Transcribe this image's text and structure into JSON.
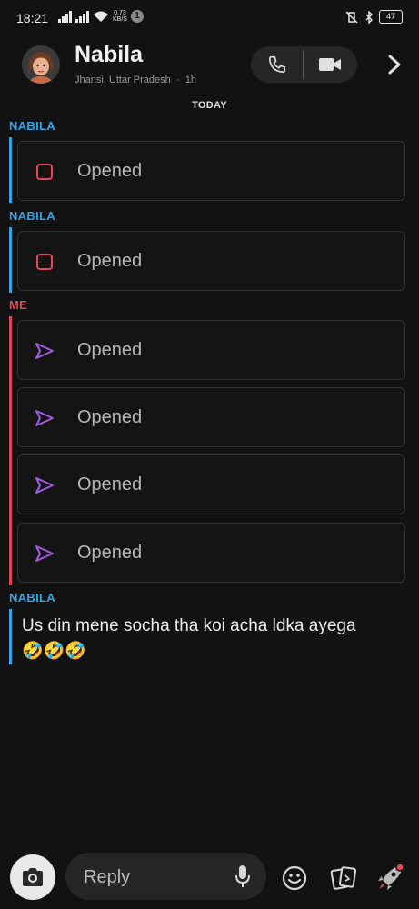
{
  "status_bar": {
    "time": "18:21",
    "net_speed_value": "0.73",
    "net_speed_unit": "KB/S",
    "notification_count": "1",
    "battery": "47"
  },
  "header": {
    "name": "Nabila",
    "location": "Jhansi, Uttar Pradesh",
    "separator": "·",
    "time_ago": "1h"
  },
  "day_label": "TODAY",
  "senders": {
    "them": "NABILA",
    "me": "ME"
  },
  "snaps": [
    {
      "status": "Opened",
      "icon": "received-snap-square-icon"
    },
    {
      "status": "Opened",
      "icon": "received-snap-square-icon"
    },
    {
      "status": "Opened",
      "icon": "sent-snap-arrow-icon"
    },
    {
      "status": "Opened",
      "icon": "sent-snap-arrow-icon"
    },
    {
      "status": "Opened",
      "icon": "sent-snap-arrow-icon"
    },
    {
      "status": "Opened",
      "icon": "sent-snap-arrow-icon"
    }
  ],
  "last_message": {
    "text": "Us din mene socha tha koi acha ldka ayega",
    "emoji": "🤣🤣🤣"
  },
  "composer": {
    "placeholder": "Reply"
  },
  "colors": {
    "them": "#2ea5e6",
    "me": "#e2475b",
    "received_snap": "#e2475b",
    "sent_snap": "#a05ce0",
    "background": "#121212"
  }
}
